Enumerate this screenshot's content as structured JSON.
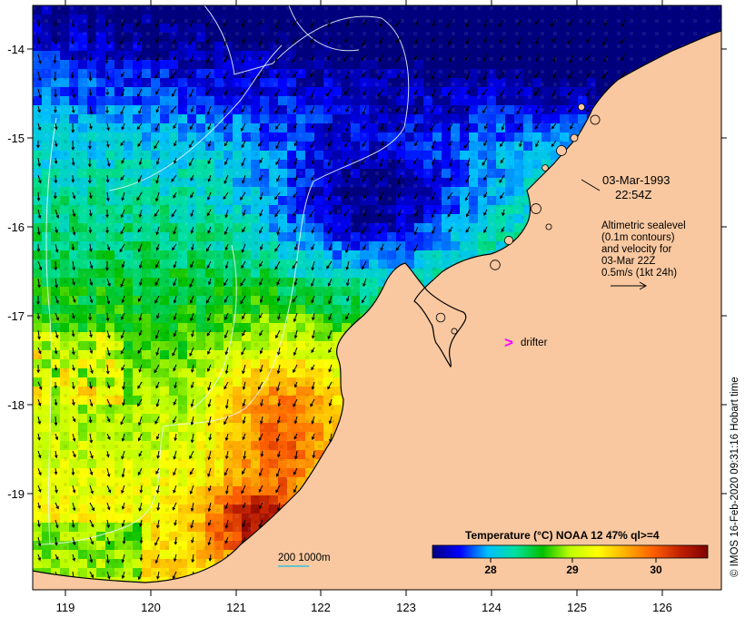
{
  "map": {
    "x_ticks": [
      "119",
      "120",
      "121",
      "122",
      "123",
      "124",
      "125",
      "126"
    ],
    "y_ticks": [
      "-14",
      "-15",
      "-16",
      "-17",
      "-18",
      "-19"
    ],
    "colors": {
      "land": "#f9c8a0",
      "coast": "#000000",
      "contour": "#e8f4f8",
      "drifter": "#ff00ff",
      "cold": "#0a1f8c",
      "warm": "#8b1a00"
    }
  },
  "annotations": {
    "date": "03-Mar-1993",
    "time": "22:54Z",
    "legend_lines": [
      "Altimetric sealevel",
      "(0.1m contours)",
      "and velocity for",
      "03-Mar 22Z",
      "0.5m/s (1kt 24h)"
    ],
    "drifter_marker": ">",
    "drifter_label": "drifter",
    "scale_label": "200  1000m"
  },
  "colorbar": {
    "title": "Temperature (°C) NOAA 12 47% ql>=4",
    "ticks": [
      "28",
      "29",
      "30"
    ],
    "stops": [
      "#00007f",
      "#0000ff",
      "#00bfff",
      "#00e0a0",
      "#00c000",
      "#c0ff00",
      "#ffff00",
      "#ffb000",
      "#ff6000",
      "#c02000",
      "#7f0000"
    ]
  },
  "credit": "© IMOS 16-Feb-2020 09:31:16 Hobart time"
}
